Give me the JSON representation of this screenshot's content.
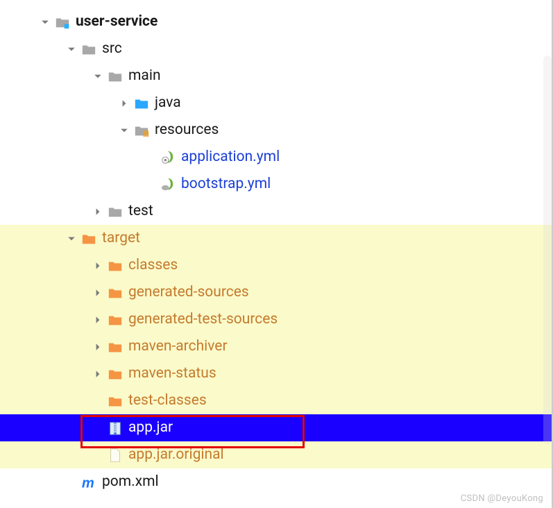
{
  "tree": {
    "root": {
      "label": "user-service"
    },
    "src": {
      "label": "src"
    },
    "main": {
      "label": "main"
    },
    "java": {
      "label": "java"
    },
    "resources": {
      "label": "resources"
    },
    "appyml": {
      "label": "application.yml"
    },
    "bootyml": {
      "label": "bootstrap.yml"
    },
    "test": {
      "label": "test"
    },
    "target": {
      "label": "target"
    },
    "classes": {
      "label": "classes"
    },
    "gensrc": {
      "label": "generated-sources"
    },
    "gentestsrc": {
      "label": "generated-test-sources"
    },
    "mavenarch": {
      "label": "maven-archiver"
    },
    "mavenstat": {
      "label": "maven-status"
    },
    "testclasses": {
      "label": "test-classes"
    },
    "appjar": {
      "label": "app.jar"
    },
    "appjarorig": {
      "label": "app.jar.original"
    },
    "pomxml": {
      "label": "pom.xml"
    }
  },
  "watermark": "CSDN @DeyouKong"
}
